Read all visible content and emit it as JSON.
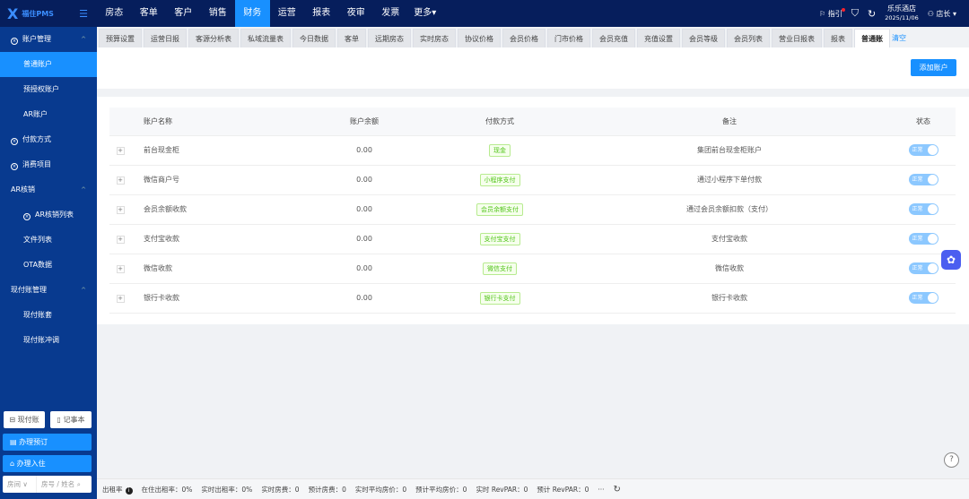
{
  "app": {
    "logo": "福住PMS"
  },
  "nav": {
    "items": [
      "房态",
      "客单",
      "客户",
      "销售",
      "财务",
      "运营",
      "报表",
      "夜审",
      "发票",
      "更多▾"
    ],
    "active": "财务"
  },
  "header": {
    "guide": "指引",
    "hotel": "乐乐酒店",
    "date": "2025/11/06",
    "user": "店长 ▾"
  },
  "sidebar": {
    "items": [
      {
        "label": "账户管理",
        "level": 0,
        "icon": true,
        "expand": true
      },
      {
        "label": "普通账户",
        "level": 1,
        "active": true
      },
      {
        "label": "预授权账户",
        "level": 1
      },
      {
        "label": "AR账户",
        "level": 1
      },
      {
        "label": "付款方式",
        "level": 0,
        "icon": true
      },
      {
        "label": "消费项目",
        "level": 0,
        "icon": true
      },
      {
        "label": "AR核销",
        "level": 0,
        "expand": true
      },
      {
        "label": "AR核销列表",
        "level": 1,
        "icon": true
      },
      {
        "label": "文件列表",
        "level": 1
      },
      {
        "label": "OTA数据",
        "level": 1
      },
      {
        "label": "现付账管理",
        "level": 0,
        "expand": true
      },
      {
        "label": "现付账套",
        "level": 1
      },
      {
        "label": "现付账冲调",
        "level": 1
      }
    ],
    "cash_btn": "现付账",
    "note_btn": "记事本",
    "reserve_btn": "办理预订",
    "checkin_btn": "办理入住",
    "search_type": "房间",
    "search_placeholder": "房号 / 姓名"
  },
  "tabs": {
    "items": [
      "预算设置",
      "运营日报",
      "客源分析表",
      "私域流量表",
      "今日数据",
      "客单",
      "远期房态",
      "实时房态",
      "协议价格",
      "会员价格",
      "门市价格",
      "会员充值",
      "充值设置",
      "会员等级",
      "会员列表",
      "营业日报表",
      "报表",
      "普通账"
    ],
    "active": "普通账",
    "clear": "清空"
  },
  "toolbar": {
    "add": "添加账户"
  },
  "table": {
    "headers": [
      "账户名称",
      "账户余额",
      "付款方式",
      "备注",
      "状态"
    ],
    "rows": [
      {
        "name": "前台现金柜",
        "balance": "0.00",
        "method": "现金",
        "remark": "集团前台现金柜账户",
        "status": "正常"
      },
      {
        "name": "微信商户号",
        "balance": "0.00",
        "method": "小程序支付",
        "remark": "通过小程序下单付款",
        "status": "正常"
      },
      {
        "name": "会员余额收款",
        "balance": "0.00",
        "method": "会员余额支付",
        "remark": "通过会员余额扣款（支付）",
        "status": "正常"
      },
      {
        "name": "支付宝收款",
        "balance": "0.00",
        "method": "支付宝支付",
        "remark": "支付宝收款",
        "status": "正常"
      },
      {
        "name": "微信收款",
        "balance": "0.00",
        "method": "微信支付",
        "remark": "微信收款",
        "status": "正常"
      },
      {
        "name": "银行卡收款",
        "balance": "0.00",
        "method": "银行卡支付",
        "remark": "银行卡收款",
        "status": "正常"
      }
    ]
  },
  "statusbar": {
    "items": [
      "出租率",
      "在住出租率：0%",
      "实时出租率：0%",
      "实时房费：0",
      "预计房费：0",
      "实时平均房价：0",
      "预计平均房价：0",
      "实时 RevPAR：0",
      "预计 RevPAR：0",
      "···"
    ]
  },
  "colors": {
    "nav": "#061e5c",
    "sidebar": "#083a8f",
    "accent": "#1890ff",
    "tag": "#52c41a"
  }
}
